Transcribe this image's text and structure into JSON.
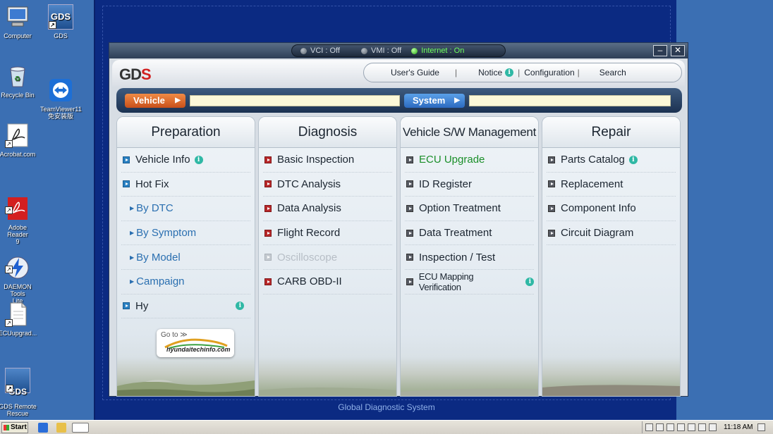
{
  "desktop": {
    "icons": [
      {
        "label": "Computer",
        "icon": "computer-icon"
      },
      {
        "label": "GDS",
        "icon": "gds-icon"
      },
      {
        "label": "Recycle Bin",
        "icon": "recycle-bin-icon"
      },
      {
        "label": "TeamViewer11\n免安装版",
        "icon": "teamviewer-icon"
      },
      {
        "label": "Acrobat.com",
        "icon": "acrobat-icon"
      },
      {
        "label": "Adobe Reader\n9",
        "icon": "adobe-reader-icon"
      },
      {
        "label": "DAEMON Tools\nLite",
        "icon": "daemon-tools-icon"
      },
      {
        "label": "ECUupgrad...",
        "icon": "file-icon"
      },
      {
        "label": "GDS Remote\nRescue",
        "icon": "gds-remote-icon"
      }
    ],
    "gds_icon_text": "GDS",
    "gds_remote_icon_text": "GDS"
  },
  "app": {
    "status": {
      "vci": "VCI : Off",
      "vmi": "VMI : Off",
      "internet": "Internet : On"
    },
    "logo": {
      "main": "GD",
      "accent": "S"
    },
    "nav": {
      "users_guide": "User's Guide",
      "notice": "Notice",
      "configuration": "Configuration",
      "search": "Search"
    },
    "info_glyph": "i",
    "searchbar": {
      "vehicle_label": "Vehicle",
      "vehicle_value": "",
      "system_label": "System",
      "system_value": ""
    },
    "panels": {
      "preparation": {
        "title": "Preparation",
        "items": {
          "vehicle_info": "Vehicle Info",
          "hot_fix": "Hot Fix",
          "by_dtc": "By DTC",
          "by_symptom": "By Symptom",
          "by_model": "By Model",
          "campaign": "Campaign",
          "last": "Hy"
        }
      },
      "diagnosis": {
        "title": "Diagnosis",
        "items": {
          "basic_inspection": "Basic Inspection",
          "dtc_analysis": "DTC Analysis",
          "data_analysis": "Data Analysis",
          "flight_record": "Flight Record",
          "oscilloscope": "Oscilloscope",
          "carb_obd": "CARB OBD-II"
        }
      },
      "sw_management": {
        "title": "Vehicle S/W Management",
        "items": {
          "ecu_upgrade": "ECU Upgrade",
          "id_register": "ID Register",
          "option_treatment": "Option Treatment",
          "data_treatment": "Data Treatment",
          "inspection_test": "Inspection / Test",
          "ecu_mapping": "ECU Mapping Verification"
        }
      },
      "repair": {
        "title": "Repair",
        "items": {
          "parts_catalog": "Parts Catalog",
          "replacement": "Replacement",
          "component_info": "Component Info",
          "circuit_diagram": "Circuit Diagram"
        }
      }
    },
    "goto_badge": {
      "label": "Go to ≫",
      "site": "hyundaitechinfo.com"
    },
    "footer": "Global Diagnostic System"
  },
  "taskbar": {
    "start": "Start",
    "clock": "11:18 AM"
  },
  "colors": {
    "desktop": "#3b6fb3",
    "gds_background": "#0b2a82",
    "vehicle_tag": "#e0703a",
    "system_tag": "#3d82d4",
    "ecu_upgrade_text": "#1b8f2a",
    "info_badge": "#2fb8a5"
  }
}
